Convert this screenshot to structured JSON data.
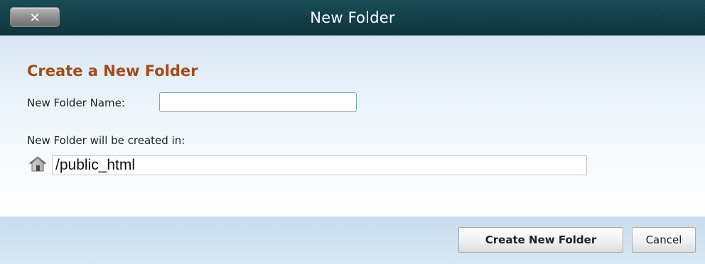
{
  "dialog": {
    "title": "New Folder",
    "close_label": "✕"
  },
  "form": {
    "heading": "Create a New Folder",
    "name_label": "New Folder Name:",
    "name_value": "",
    "location_label": "New Folder will be created in:",
    "location_icon": "home-icon",
    "location_value": "/public_html"
  },
  "footer": {
    "create_label": "Create New Folder",
    "cancel_label": "Cancel"
  },
  "colors": {
    "titlebar": "#0d3a44",
    "heading": "#a44a17",
    "body_gradient_top": "#d7e7f4",
    "footer": "#c6dcee"
  }
}
